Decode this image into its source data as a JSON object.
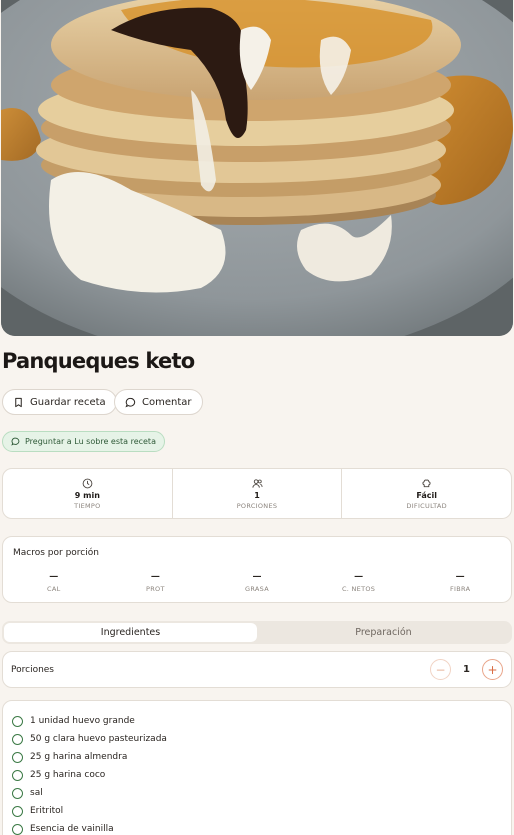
{
  "recipe": {
    "title": "Panqueques keto",
    "save_label": "Guardar receta",
    "comment_label": "Comentar",
    "ask_label": "Preguntar a Lu sobre esta receta"
  },
  "stats": [
    {
      "icon": "clock-icon",
      "value": "9 min",
      "label": "TIEMPO"
    },
    {
      "icon": "people-icon",
      "value": "1",
      "label": "PORCIONES"
    },
    {
      "icon": "chef-hat-icon",
      "value": "Fácil",
      "label": "DIFICULTAD"
    }
  ],
  "macros": {
    "title": "Macros por porción",
    "items": [
      {
        "value": "—",
        "label": "CAL"
      },
      {
        "value": "—",
        "label": "PROT"
      },
      {
        "value": "—",
        "label": "GRASA"
      },
      {
        "value": "—",
        "label": "C. NETOS"
      },
      {
        "value": "—",
        "label": "FIBRA"
      }
    ]
  },
  "tabs": [
    {
      "label": "Ingredientes",
      "active": true
    },
    {
      "label": "Preparación",
      "active": false
    }
  ],
  "portions": {
    "label": "Porciones",
    "value": "1",
    "minus": "−",
    "plus": "+"
  },
  "ingredients": [
    "1 unidad huevo grande",
    "50 g clara huevo pasteurizada",
    "25 g harina almendra",
    "25 g harina coco",
    "sal",
    "Eritritol",
    "Esencia de vainilla"
  ],
  "colors": {
    "background": "#f8f4ef",
    "accent": "#d9693f",
    "green": "#3b7a45"
  }
}
